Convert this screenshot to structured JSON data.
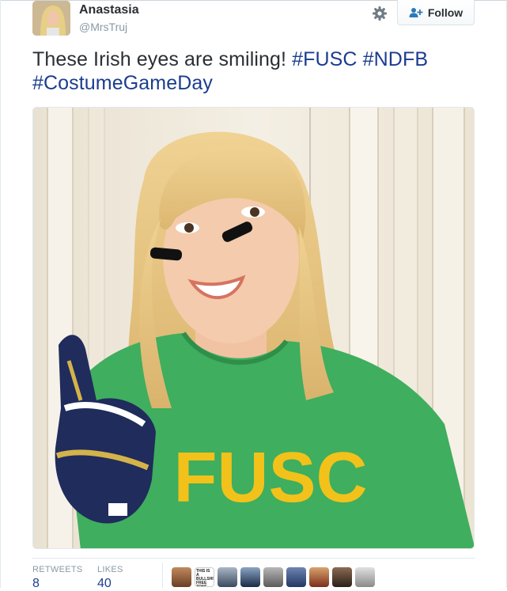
{
  "user": {
    "display_name": "Anastasia",
    "screen_name": "@MrsTruj"
  },
  "header": {
    "follow_label": "Follow",
    "settings_icon": "gear-icon",
    "follow_icon": "add-user-icon"
  },
  "tweet": {
    "text_prefix": "These Irish eyes are smiling! ",
    "hashtags": [
      "#FUSC",
      "#NDFB",
      "#CostumeGameDay"
    ]
  },
  "photo": {
    "shirt_text": "FUSC"
  },
  "stats": {
    "retweets_label": "RETWEETS",
    "retweets_count": "8",
    "likes_label": "LIKES",
    "likes_count": "40",
    "liker_badge_text": "THIS IS A BULLSHIT FREE ZONE"
  },
  "colors": {
    "hashtag": "#1b3d8f",
    "text": "#292f33",
    "muted": "#8899a6",
    "shirt_green": "#3fae5e",
    "shirt_text_yellow": "#f2c21b"
  }
}
